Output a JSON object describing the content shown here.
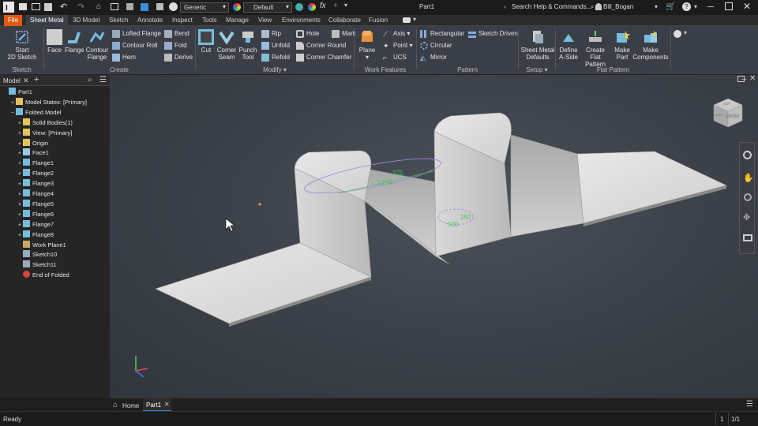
{
  "titlebar": {
    "style_value": "Generic",
    "material_value": "Default",
    "doc_title": "Part1",
    "search_placeholder": "Search Help & Commands...",
    "user": "Bill_Bogan"
  },
  "tabs": [
    {
      "label": "File"
    },
    {
      "label": "Sheet Metal"
    },
    {
      "label": "3D Model"
    },
    {
      "label": "Sketch"
    },
    {
      "label": "Annotate"
    },
    {
      "label": "Inspect"
    },
    {
      "label": "Tools"
    },
    {
      "label": "Manage"
    },
    {
      "label": "View"
    },
    {
      "label": "Environments"
    },
    {
      "label": "Collaborate"
    },
    {
      "label": "Fusion"
    }
  ],
  "ribbon": {
    "sketch": {
      "start": "Start",
      "start2": "2D Sketch",
      "label": "Sketch"
    },
    "create": {
      "face": "Face",
      "flange": "Flange",
      "contour": "Contour",
      "contour2": "Flange",
      "lofted": "Lofted Flange",
      "contour_roll": "Contour Roll",
      "hem": "Hem",
      "bend": "Bend",
      "fold": "Fold",
      "derive": "Derive",
      "label": "Create"
    },
    "modify": {
      "cut": "Cut",
      "corner": "Corner",
      "corner2": "Seam",
      "punch": "Punch",
      "punch2": "Tool",
      "rip": "Rip",
      "unfold": "Unfold",
      "refold": "Refold",
      "hole": "Hole",
      "mark": "Mark",
      "corner_round": "Corner Round",
      "corner_chamfer": "Corner Chamfer",
      "label": "Modify"
    },
    "work": {
      "plane": "Plane",
      "axis": "Axis",
      "point": "Point",
      "ucs": "UCS",
      "label": "Work Features"
    },
    "pattern": {
      "rect": "Rectangular",
      "circ": "Circular",
      "mirror": "Mirror",
      "sketch_driven": "Sketch Driven",
      "label": "Pattern"
    },
    "setup": {
      "defaults": "Sheet Metal",
      "defaults2": "Defaults",
      "label": "Setup"
    },
    "flat": {
      "define": "Define",
      "define2": "A-Side",
      "create": "Create",
      "create2": "Flat Pattern",
      "make_part": "Make",
      "make_part2": "Part",
      "make_comp": "Make",
      "make_comp2": "Components",
      "label": "Flat Pattern"
    }
  },
  "panel": {
    "title": "Model"
  },
  "tree": [
    {
      "label": "Part1",
      "depth": 0,
      "exp": "",
      "icon": "part-icon"
    },
    {
      "label": "Model States: [Primary]",
      "depth": 1,
      "exp": "+",
      "icon": "folder-icon"
    },
    {
      "label": "Folded Model",
      "depth": 1,
      "exp": "−",
      "icon": "folded-model-icon"
    },
    {
      "label": "Solid Bodies(1)",
      "depth": 2,
      "exp": "+",
      "icon": "folder-icon"
    },
    {
      "label": "View: [Primary]",
      "depth": 2,
      "exp": "+",
      "icon": "folder-icon"
    },
    {
      "label": "Origin",
      "depth": 2,
      "exp": "+",
      "icon": "folder-icon"
    },
    {
      "label": "Face1",
      "depth": 2,
      "exp": "+",
      "icon": "face-icon"
    },
    {
      "label": "Flange1",
      "depth": 2,
      "exp": "+",
      "icon": "flange-icon"
    },
    {
      "label": "Flange2",
      "depth": 2,
      "exp": "+",
      "icon": "flange-icon"
    },
    {
      "label": "Flange3",
      "depth": 2,
      "exp": "+",
      "icon": "flange-icon"
    },
    {
      "label": "Flange4",
      "depth": 2,
      "exp": "+",
      "icon": "flange-icon"
    },
    {
      "label": "Flange5",
      "depth": 2,
      "exp": "+",
      "icon": "flange-icon"
    },
    {
      "label": "Flange6",
      "depth": 2,
      "exp": "+",
      "icon": "flange-icon"
    },
    {
      "label": "Flange7",
      "depth": 2,
      "exp": "+",
      "icon": "flange-icon"
    },
    {
      "label": "Flange8",
      "depth": 2,
      "exp": "+",
      "icon": "flange-icon"
    },
    {
      "label": "Work Plane1",
      "depth": 2,
      "exp": "",
      "icon": "workplane-icon"
    },
    {
      "label": "Sketch10",
      "depth": 2,
      "exp": "",
      "icon": "sketch-icon"
    },
    {
      "label": "Sketch11",
      "depth": 2,
      "exp": "",
      "icon": "sketch-icon"
    },
    {
      "label": "End of Folded",
      "depth": 2,
      "exp": "",
      "icon": "end-of-part-icon"
    }
  ],
  "viewport": {
    "dims": [
      "375",
      "1.250",
      "250",
      "500"
    ],
    "viewcube_top": "TOP",
    "viewcube_front": "FRONT",
    "viewcube_left": "LEFT"
  },
  "doctabs": {
    "home": "Home",
    "part": "Part1"
  },
  "status": {
    "text": "Ready",
    "count1": "1",
    "count2": "1/1"
  }
}
